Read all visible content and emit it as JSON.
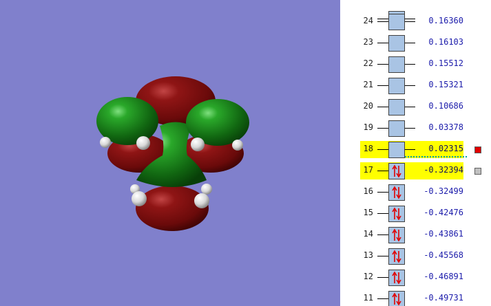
{
  "viewer": {
    "background_color": "#8080cc"
  },
  "orbitals": [
    {
      "number": "24",
      "energy": "0.16360",
      "occupied": false,
      "highlighted": false
    },
    {
      "number": "23",
      "energy": "0.16103",
      "occupied": false,
      "highlighted": false
    },
    {
      "number": "22",
      "energy": "0.15512",
      "occupied": false,
      "highlighted": false
    },
    {
      "number": "21",
      "energy": "0.15321",
      "occupied": false,
      "highlighted": false
    },
    {
      "number": "20",
      "energy": "0.10686",
      "occupied": false,
      "highlighted": false
    },
    {
      "number": "19",
      "energy": "0.03378",
      "occupied": false,
      "highlighted": false
    },
    {
      "number": "18",
      "energy": "0.02315",
      "occupied": false,
      "highlighted": true,
      "marker_color": "#e00000"
    },
    {
      "number": "17",
      "energy": "-0.32394",
      "occupied": true,
      "highlighted": true,
      "marker_color": "#c0c0c0"
    },
    {
      "number": "16",
      "energy": "-0.32499",
      "occupied": true,
      "highlighted": false
    },
    {
      "number": "15",
      "energy": "-0.42476",
      "occupied": true,
      "highlighted": false
    },
    {
      "number": "14",
      "energy": "-0.43861",
      "occupied": true,
      "highlighted": false
    },
    {
      "number": "13",
      "energy": "-0.45568",
      "occupied": true,
      "highlighted": false
    },
    {
      "number": "12",
      "energy": "-0.46891",
      "occupied": true,
      "highlighted": false
    },
    {
      "number": "11",
      "energy": "-0.49731",
      "occupied": true,
      "highlighted": false
    }
  ],
  "colors": {
    "positive_lobe": "#1f8a1f",
    "negative_lobe": "#8a1212",
    "hydrogen": "#e8e8e8",
    "highlight": "#ffff00",
    "orbital_box": "#a9c4e4",
    "spin_arrow": "#e00000",
    "energy_text": "#1a1aaa",
    "homo_lumo_gap_line": "#00a0a0"
  }
}
